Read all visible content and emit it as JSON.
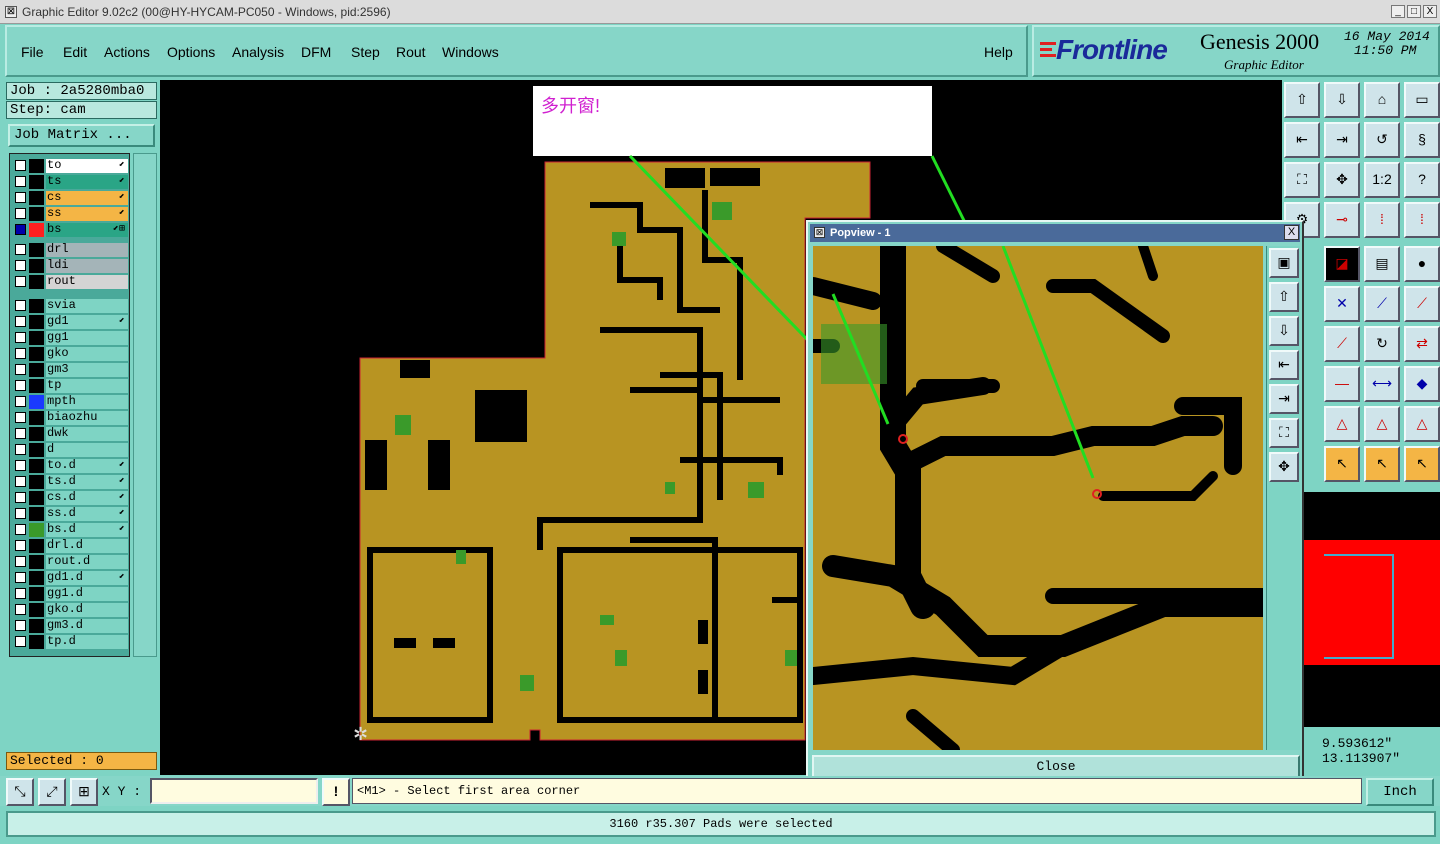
{
  "window_title": "Graphic Editor 9.02c2 (00@HY-HYCAM-PC050 - Windows, pid:2596)",
  "window_buttons": {
    "min": "_",
    "max": "□",
    "close": "X"
  },
  "menu": [
    "File",
    "Edit",
    "Actions",
    "Options",
    "Analysis",
    "DFM",
    "Step",
    "Rout",
    "Windows"
  ],
  "help": "Help",
  "logo": {
    "brand": "Frontline",
    "product": "Genesis 2000",
    "subtitle": "Graphic Editor",
    "date": "16 May 2014",
    "time": "11:50 PM"
  },
  "job": "Job : 2a5280mba0",
  "step": "Step: cam",
  "job_matrix": "Job Matrix ...",
  "layers": [
    {
      "name": "to",
      "color": "#000000",
      "bg": "#ffffff",
      "mark": "⬋"
    },
    {
      "name": "ts",
      "color": "#000000",
      "bg": "#2aa586",
      "mark": "⬋"
    },
    {
      "name": "cs",
      "color": "#000000",
      "bg": "#f4b545",
      "mark": "⬋"
    },
    {
      "name": "ss",
      "color": "#000000",
      "bg": "#f4b545",
      "mark": "⬋"
    },
    {
      "name": "bs",
      "color": "#ff2020",
      "bg": "#2aa586",
      "mark": "⬋⊞",
      "active": true
    },
    {
      "name": "drl",
      "color": "#000000",
      "bg": "#a4b4b8",
      "mark": ""
    },
    {
      "name": "ldi",
      "color": "#000000",
      "bg": "#a4b4b8",
      "mark": ""
    },
    {
      "name": "rout",
      "color": "#000000",
      "bg": "#d4d4d4",
      "mark": ""
    },
    {
      "name": "svia",
      "color": "#000000",
      "bg": "#7ed4c4",
      "mark": ""
    },
    {
      "name": "gd1",
      "color": "#000000",
      "bg": "#7ed4c4",
      "mark": "⬋"
    },
    {
      "name": "gg1",
      "color": "#000000",
      "bg": "#7ed4c4",
      "mark": ""
    },
    {
      "name": "gko",
      "color": "#000000",
      "bg": "#7ed4c4",
      "mark": ""
    },
    {
      "name": "gm3",
      "color": "#000000",
      "bg": "#7ed4c4",
      "mark": ""
    },
    {
      "name": "tp",
      "color": "#000000",
      "bg": "#7ed4c4",
      "mark": ""
    },
    {
      "name": "mpth",
      "color": "#1a3aff",
      "bg": "#7ed4c4",
      "mark": ""
    },
    {
      "name": "biaozhu",
      "color": "#000000",
      "bg": "#7ed4c4",
      "mark": ""
    },
    {
      "name": "dwk",
      "color": "#000000",
      "bg": "#7ed4c4",
      "mark": ""
    },
    {
      "name": "d",
      "color": "#000000",
      "bg": "#7ed4c4",
      "mark": ""
    },
    {
      "name": "to.d",
      "color": "#000000",
      "bg": "#7ed4c4",
      "mark": "⬋"
    },
    {
      "name": "ts.d",
      "color": "#000000",
      "bg": "#7ed4c4",
      "mark": "⬋"
    },
    {
      "name": "cs.d",
      "color": "#000000",
      "bg": "#7ed4c4",
      "mark": "⬋"
    },
    {
      "name": "ss.d",
      "color": "#000000",
      "bg": "#7ed4c4",
      "mark": "⬋"
    },
    {
      "name": "bs.d",
      "color": "#3a9a2a",
      "bg": "#7ed4c4",
      "mark": "⬋"
    },
    {
      "name": "drl.d",
      "color": "#000000",
      "bg": "#7ed4c4",
      "mark": ""
    },
    {
      "name": "rout.d",
      "color": "#000000",
      "bg": "#7ed4c4",
      "mark": ""
    },
    {
      "name": "gd1.d",
      "color": "#000000",
      "bg": "#7ed4c4",
      "mark": "⬋"
    },
    {
      "name": "gg1.d",
      "color": "#000000",
      "bg": "#7ed4c4",
      "mark": ""
    },
    {
      "name": "gko.d",
      "color": "#000000",
      "bg": "#7ed4c4",
      "mark": ""
    },
    {
      "name": "gm3.d",
      "color": "#000000",
      "bg": "#7ed4c4",
      "mark": ""
    },
    {
      "name": "tp.d",
      "color": "#000000",
      "bg": "#7ed4c4",
      "mark": ""
    }
  ],
  "selected": "Selected : 0",
  "annotation": "多开窗!",
  "popview": {
    "title": "Popview - 1",
    "close": "Close",
    "close_x": "X"
  },
  "coords": {
    "x": "9.593612\"",
    "y": "13.113907\""
  },
  "xy_label": "X Y :",
  "xy_value": "",
  "prompt": "<M1> - Select first area corner",
  "unit": "Inch",
  "status": "3160 r35.307 Pads were selected",
  "colors": {
    "copper": "#b89422",
    "trace": "#000000",
    "pad": "#3a9a2a",
    "background": "#000000"
  }
}
